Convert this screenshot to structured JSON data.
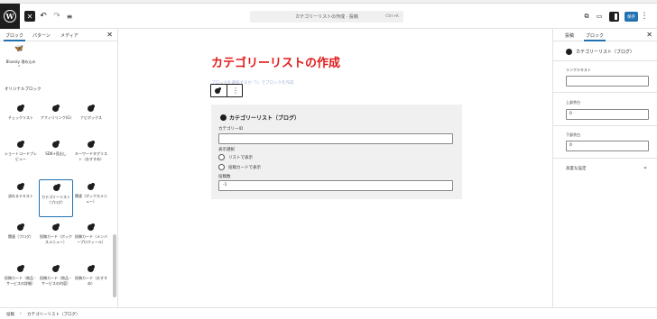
{
  "topbar": {
    "close_glyph": "✕",
    "undo_glyph": "↶",
    "redo_glyph": "↷",
    "list_view_glyph": "≡",
    "document_title": "カテゴリーリストの作成 · 投稿",
    "shortcut": "Ctrl+K",
    "view_glyph": "⧉",
    "preview_glyph": "▭",
    "save_label": "保存",
    "more_glyph": "⋮",
    "logo_letter": "W"
  },
  "left_panel": {
    "tabs": [
      "ブロック",
      "パターン",
      "メディア"
    ],
    "close_glyph": "✕",
    "bluesky_label": "Bluesky 埋め込み",
    "section_title": "オリジナルブロック",
    "blocks": [
      {
        "label": "チェックリスト"
      },
      {
        "label": "アフィリリンク(G)"
      },
      {
        "label": "ナビボックス"
      },
      {
        "label": "ショートコードプレビュー"
      },
      {
        "label": "SDK+見出し"
      },
      {
        "label": "キーワードタグリスト（おすすめ）"
      },
      {
        "label": "流れるテキスト"
      },
      {
        "label": "カテゴリーリスト（ブログ）"
      },
      {
        "label": "関連（ボックスメニュー）"
      },
      {
        "label": "関連（ブログ）"
      },
      {
        "label": "投稿カード（ボックスメニュー）"
      },
      {
        "label": "投稿カード（メンバープロフィール）"
      },
      {
        "label": "投稿カード（商品・サービスの詳細）"
      },
      {
        "label": "投稿カード（商品・サービスの内容）"
      },
      {
        "label": "投稿カード（おすすめ）"
      }
    ]
  },
  "canvas": {
    "post_title": "カテゴリーリストの作成",
    "block_placeholder": "ブロックを選択するか「/」でブロックを作成",
    "more_glyph": "⋮",
    "block": {
      "title": "カテゴリーリスト（ブログ）",
      "category_label": "カテゴリーID",
      "category_value": "",
      "display_label": "表示選択",
      "option_list": "リストで表示",
      "option_card": "投稿カードで表示",
      "count_label": "投稿数",
      "count_value": "-1"
    }
  },
  "right_panel": {
    "tabs": [
      "投稿",
      "ブロック"
    ],
    "close_glyph": "✕",
    "block_name": "カテゴリーリスト（ブログ）",
    "fields": [
      {
        "label": "リンクテキスト",
        "value": ""
      },
      {
        "label": "上部余白",
        "value": "0"
      },
      {
        "label": "下部余白",
        "value": "0"
      }
    ],
    "advanced_label": "高度な設定",
    "advanced_chevron": "⌄"
  },
  "footer": {
    "crumb_root": "投稿",
    "separator": "›",
    "crumb_block": "カテゴリーリスト（ブログ）"
  }
}
